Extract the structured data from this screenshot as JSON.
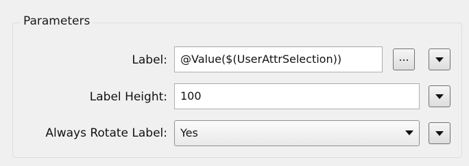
{
  "panel": {
    "title": "Parameters"
  },
  "params": {
    "label": {
      "label": "Label:",
      "value": "@Value($(UserAttrSelection))",
      "ellipsis": "..."
    },
    "label_height": {
      "label": "Label Height:",
      "value": "100"
    },
    "always_rotate": {
      "label": "Always Rotate Label:",
      "value": "Yes"
    }
  },
  "icons": {
    "ellipsis_button": "ellipsis-icon",
    "dropdown": "triangle-down-icon"
  }
}
